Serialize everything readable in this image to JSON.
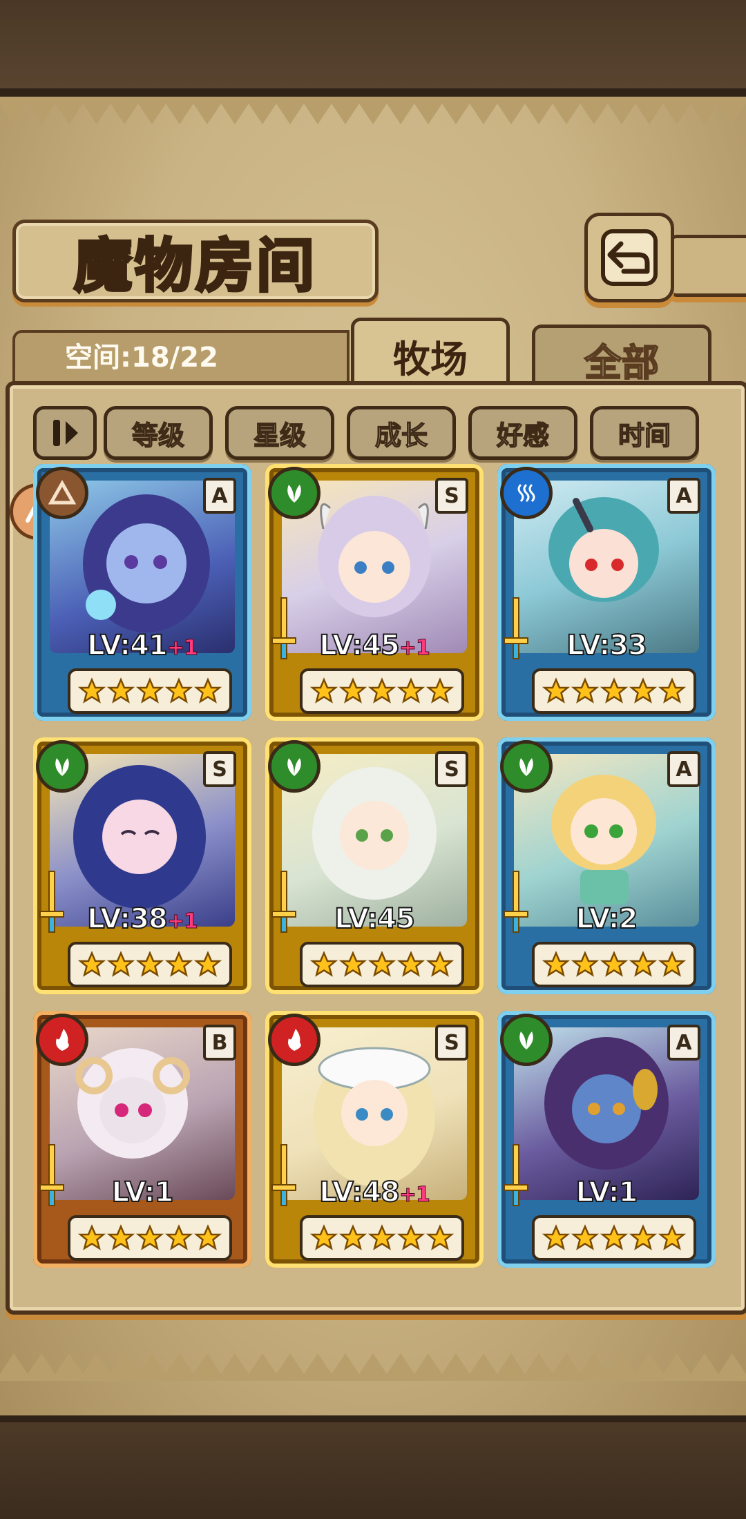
{
  "header": {
    "title": "魔物房间",
    "back_icon": "return-arrow-icon"
  },
  "tabs": {
    "space_label": "空间:18/22",
    "active": "牧场",
    "inactive": "全部"
  },
  "filters": {
    "sort_icon": "sort-toggle-icon",
    "sort_glyph": "⇂⇃",
    "buttons": [
      "等级",
      "星级",
      "成长",
      "好感",
      "时间"
    ]
  },
  "colors": {
    "grass": "#2f8c2a",
    "water": "#1d6fd0",
    "fire": "#d02222",
    "frame_blue": "#2a6fa3",
    "frame_gold": "#b9860a",
    "frame_bronze": "#a7591c"
  },
  "monsters": [
    {
      "level": "LV:41",
      "bonus": "+1",
      "rank": "A",
      "element": "earth",
      "frame": "blue",
      "stars": 5
    },
    {
      "level": "LV:45",
      "bonus": "+1",
      "rank": "S",
      "element": "grass",
      "frame": "gold",
      "stars": 5
    },
    {
      "level": "LV:33",
      "bonus": "",
      "rank": "A",
      "element": "water",
      "frame": "blue",
      "stars": 5
    },
    {
      "level": "LV:38",
      "bonus": "+1",
      "rank": "S",
      "element": "grass",
      "frame": "gold",
      "stars": 5
    },
    {
      "level": "LV:45",
      "bonus": "",
      "rank": "S",
      "element": "grass",
      "frame": "gold",
      "stars": 5
    },
    {
      "level": "LV:2",
      "bonus": "",
      "rank": "A",
      "element": "grass",
      "frame": "blue",
      "stars": 5
    },
    {
      "level": "LV:1",
      "bonus": "",
      "rank": "B",
      "element": "fire",
      "frame": "bronze",
      "stars": 5
    },
    {
      "level": "LV:48",
      "bonus": "+1",
      "rank": "S",
      "element": "fire",
      "frame": "gold",
      "stars": 5
    },
    {
      "level": "LV:1",
      "bonus": "",
      "rank": "A",
      "element": "grass",
      "frame": "blue",
      "stars": 5
    }
  ]
}
